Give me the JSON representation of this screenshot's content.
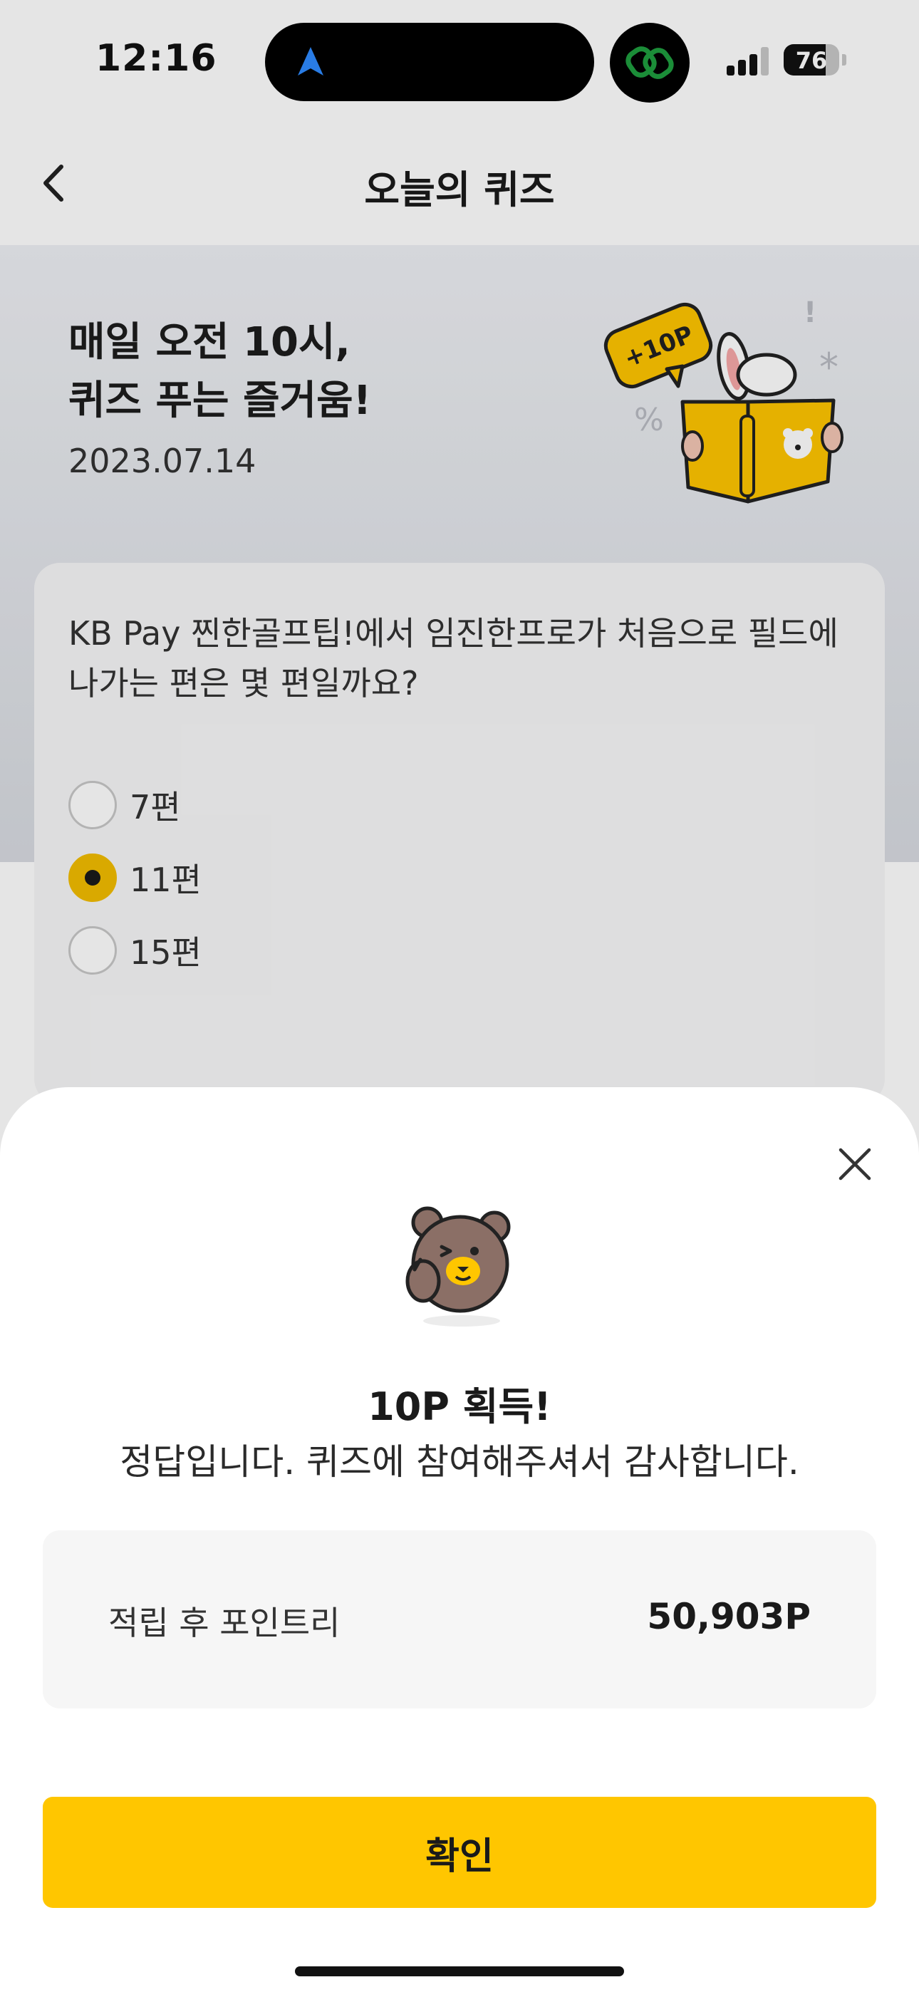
{
  "status_bar": {
    "time": "12:16",
    "battery_percent": "76",
    "battery_level": 0.76,
    "signal_bars": 3,
    "signal_bars_total": 4,
    "nav_icon": "location-arrow-icon",
    "app_icon": "link-rings-icon",
    "app_icon_color": "#1f9d3f"
  },
  "header": {
    "title": "오늘의 퀴즈",
    "back_icon": "chevron-left-icon"
  },
  "hero": {
    "title_line1": "매일 오전 10시,",
    "title_line2": "퀴즈 푸는 즐거움!",
    "date": "2023.07.14",
    "badge_text": "+10P"
  },
  "quiz": {
    "question": "KB Pay 찐한골프팁!에서 임진한프로가 처음으로 필드에 나가는 편은 몇 편일까요?",
    "options": [
      {
        "label": "7편",
        "selected": false
      },
      {
        "label": "11편",
        "selected": true
      },
      {
        "label": "15편",
        "selected": false
      }
    ]
  },
  "result_sheet": {
    "close_icon": "close-icon",
    "title": "10P 획득!",
    "message": "정답입니다. 퀴즈에 참여해주셔서 감사합니다.",
    "points_label": "적립 후 포인트리",
    "points_value": "50,903P",
    "confirm_label": "확인"
  },
  "colors": {
    "accent": "#ffc600",
    "radio_selected": "#f2bd00",
    "hero_bg_top": "#eef0f4",
    "hero_bg_bottom": "#d8dbe1"
  }
}
